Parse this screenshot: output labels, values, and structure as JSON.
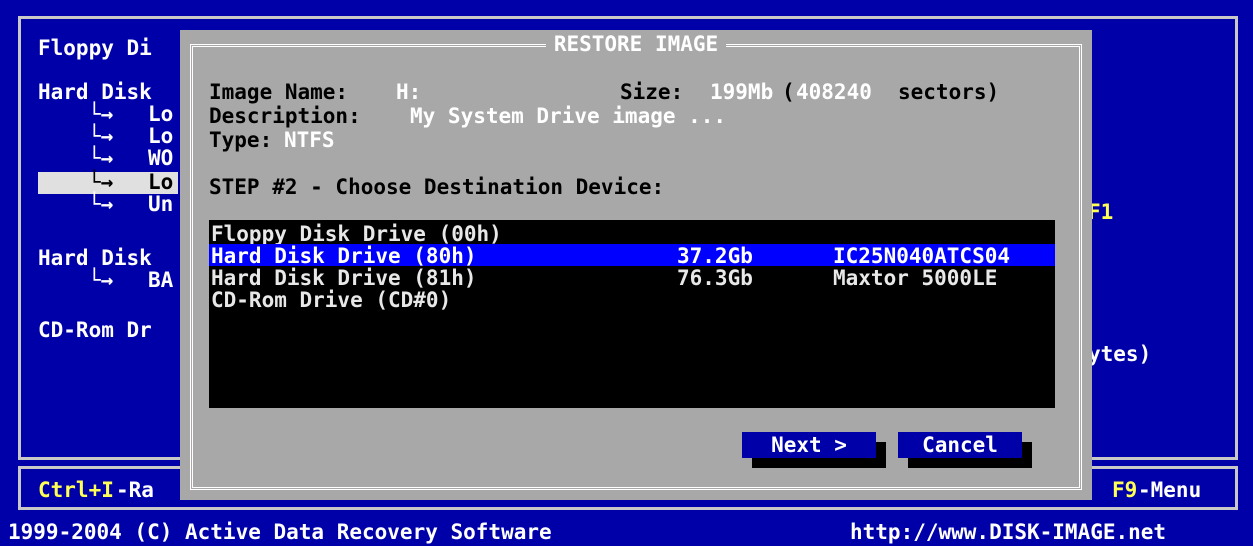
{
  "background": {
    "items": [
      "Floppy Di",
      "Hard Disk",
      "Lo",
      "Lo",
      "WO",
      "Lo",
      "Un",
      "Hard Disk",
      "BA",
      "CD-Rom Dr"
    ],
    "right_f1": "F1",
    "right_bytes": "ytes)"
  },
  "dialog": {
    "title": "RESTORE IMAGE",
    "image_name_label": "Image Name:",
    "image_name_value": "H:",
    "size_label": "Size:",
    "size_value": "199Mb",
    "sectors_open": "(",
    "sectors_value": "408240",
    "sectors_label": "sectors)",
    "description_label": "Description:",
    "description_value": "My System Drive image ...",
    "type_label": "Type:",
    "type_value": "NTFS",
    "step": "STEP #2 - Choose Destination Device:",
    "devices": [
      {
        "name": "Floppy Disk Drive (00h)",
        "size": "",
        "model": ""
      },
      {
        "name": "Hard Disk Drive (80h)",
        "size": "37.2Gb",
        "model": "IC25N040ATCS04"
      },
      {
        "name": "Hard Disk Drive (81h)",
        "size": "76.3Gb",
        "model": "Maxtor 5000LE"
      },
      {
        "name": "CD-Rom Drive (CD#0)",
        "size": "",
        "model": ""
      }
    ],
    "next_label": "Next >",
    "cancel_label": "Cancel"
  },
  "statusbar": {
    "left_key": "Ctrl+I",
    "left_text": "-Ra",
    "right_key": "F9",
    "right_text": "-Menu"
  },
  "footer": {
    "copyright": "1999-2004 (C) Active Data Recovery Software",
    "url": "http://www.DISK-IMAGE.net"
  },
  "colors": {
    "screen_bg": "#0000a8",
    "dialog_bg": "#a8a8a8",
    "highlight": "#0000ff",
    "key_color": "#ffff55"
  }
}
